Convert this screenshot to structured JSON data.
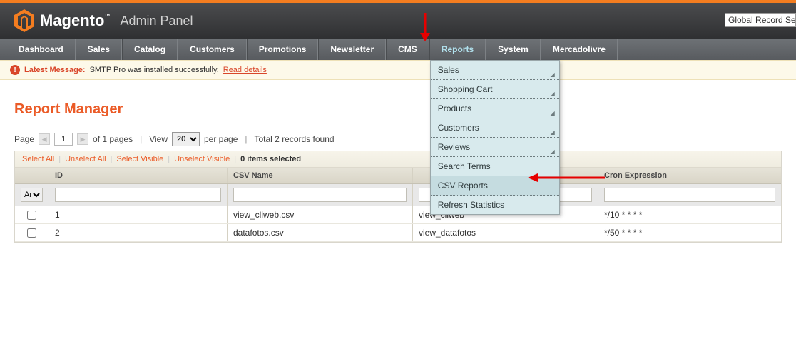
{
  "header": {
    "brand": "Magento",
    "brand_tm": "™",
    "panel": "Admin Panel",
    "global_search": "Global Record Se"
  },
  "nav": {
    "items": [
      "Dashboard",
      "Sales",
      "Catalog",
      "Customers",
      "Promotions",
      "Newsletter",
      "CMS",
      "Reports",
      "System",
      "Mercadolivre"
    ],
    "reports_submenu": [
      "Sales",
      "Shopping Cart",
      "Products",
      "Customers",
      "Reviews",
      "Search Terms",
      "CSV Reports",
      "Refresh Statistics"
    ]
  },
  "notice": {
    "label": "Latest Message:",
    "message": "SMTP Pro was installed successfully.",
    "link": "Read details"
  },
  "page": {
    "title": "Report Manager"
  },
  "pager": {
    "page_label": "Page",
    "page_value": "1",
    "of_pages": "of 1 pages",
    "view_label": "View",
    "per_page_value": "20",
    "per_page_label": "per page",
    "total": "Total 2 records found"
  },
  "massaction": {
    "select_all": "Select All",
    "unselect_all": "Unselect All",
    "select_visible": "Select Visible",
    "unselect_visible": "Unselect Visible",
    "items_selected": "0 items selected"
  },
  "grid": {
    "headers": {
      "id": "ID",
      "csv_name": "CSV Name",
      "view": "",
      "cron": "Cron Expression"
    },
    "filter_any": "Any",
    "rows": [
      {
        "id": "1",
        "csv_name": "view_cliweb.csv",
        "view": "view_cliweb",
        "cron": "*/10 * * * *"
      },
      {
        "id": "2",
        "csv_name": "datafotos.csv",
        "view": "view_datafotos",
        "cron": "*/50 * * * *"
      }
    ]
  }
}
